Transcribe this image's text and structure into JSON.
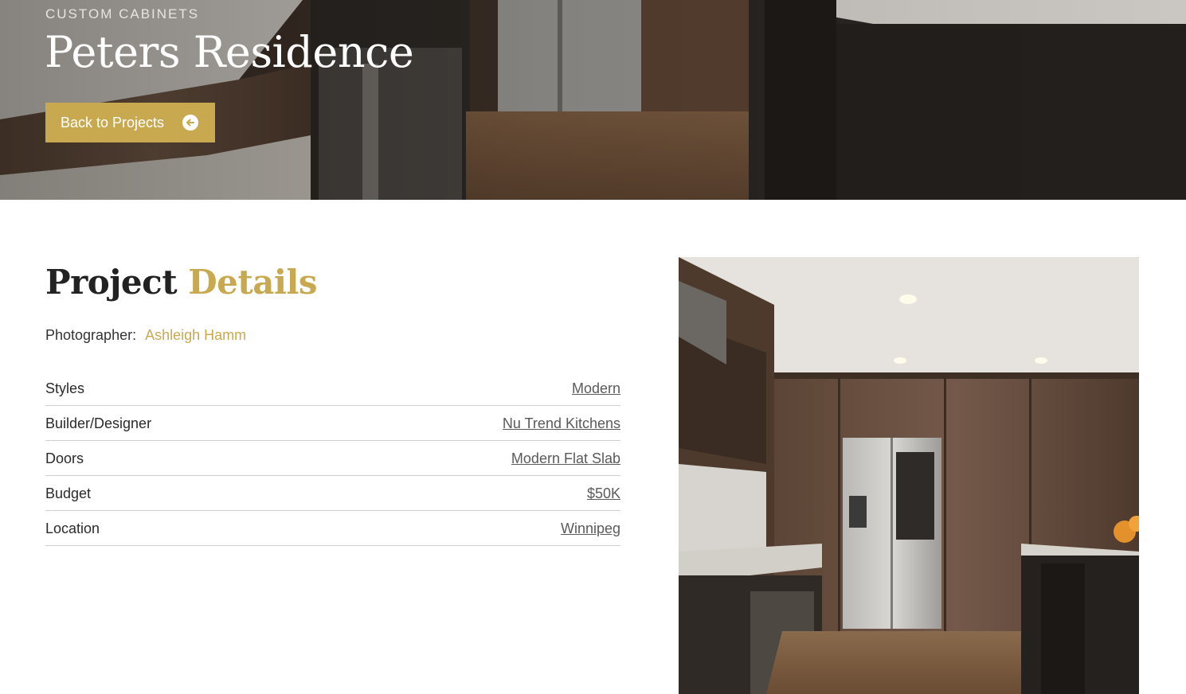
{
  "hero": {
    "eyebrow": "CUSTOM CABINETS",
    "title": "Peters Residence",
    "back_button_label": "Back to Projects",
    "back_button_icon": "arrow-left-circle-icon",
    "accent_color": "#c9a94f"
  },
  "details": {
    "title_part1": "Project",
    "title_part2": "Details",
    "photographer_label": "Photographer:",
    "photographer_name": "Ashleigh Hamm",
    "specs": [
      {
        "label": "Styles",
        "value": "Modern"
      },
      {
        "label": "Builder/Designer",
        "value": "Nu Trend Kitchens"
      },
      {
        "label": "Doors",
        "value": "Modern Flat Slab"
      },
      {
        "label": "Budget",
        "value": "$50K"
      },
      {
        "label": "Location",
        "value": "Winnipeg"
      }
    ]
  }
}
